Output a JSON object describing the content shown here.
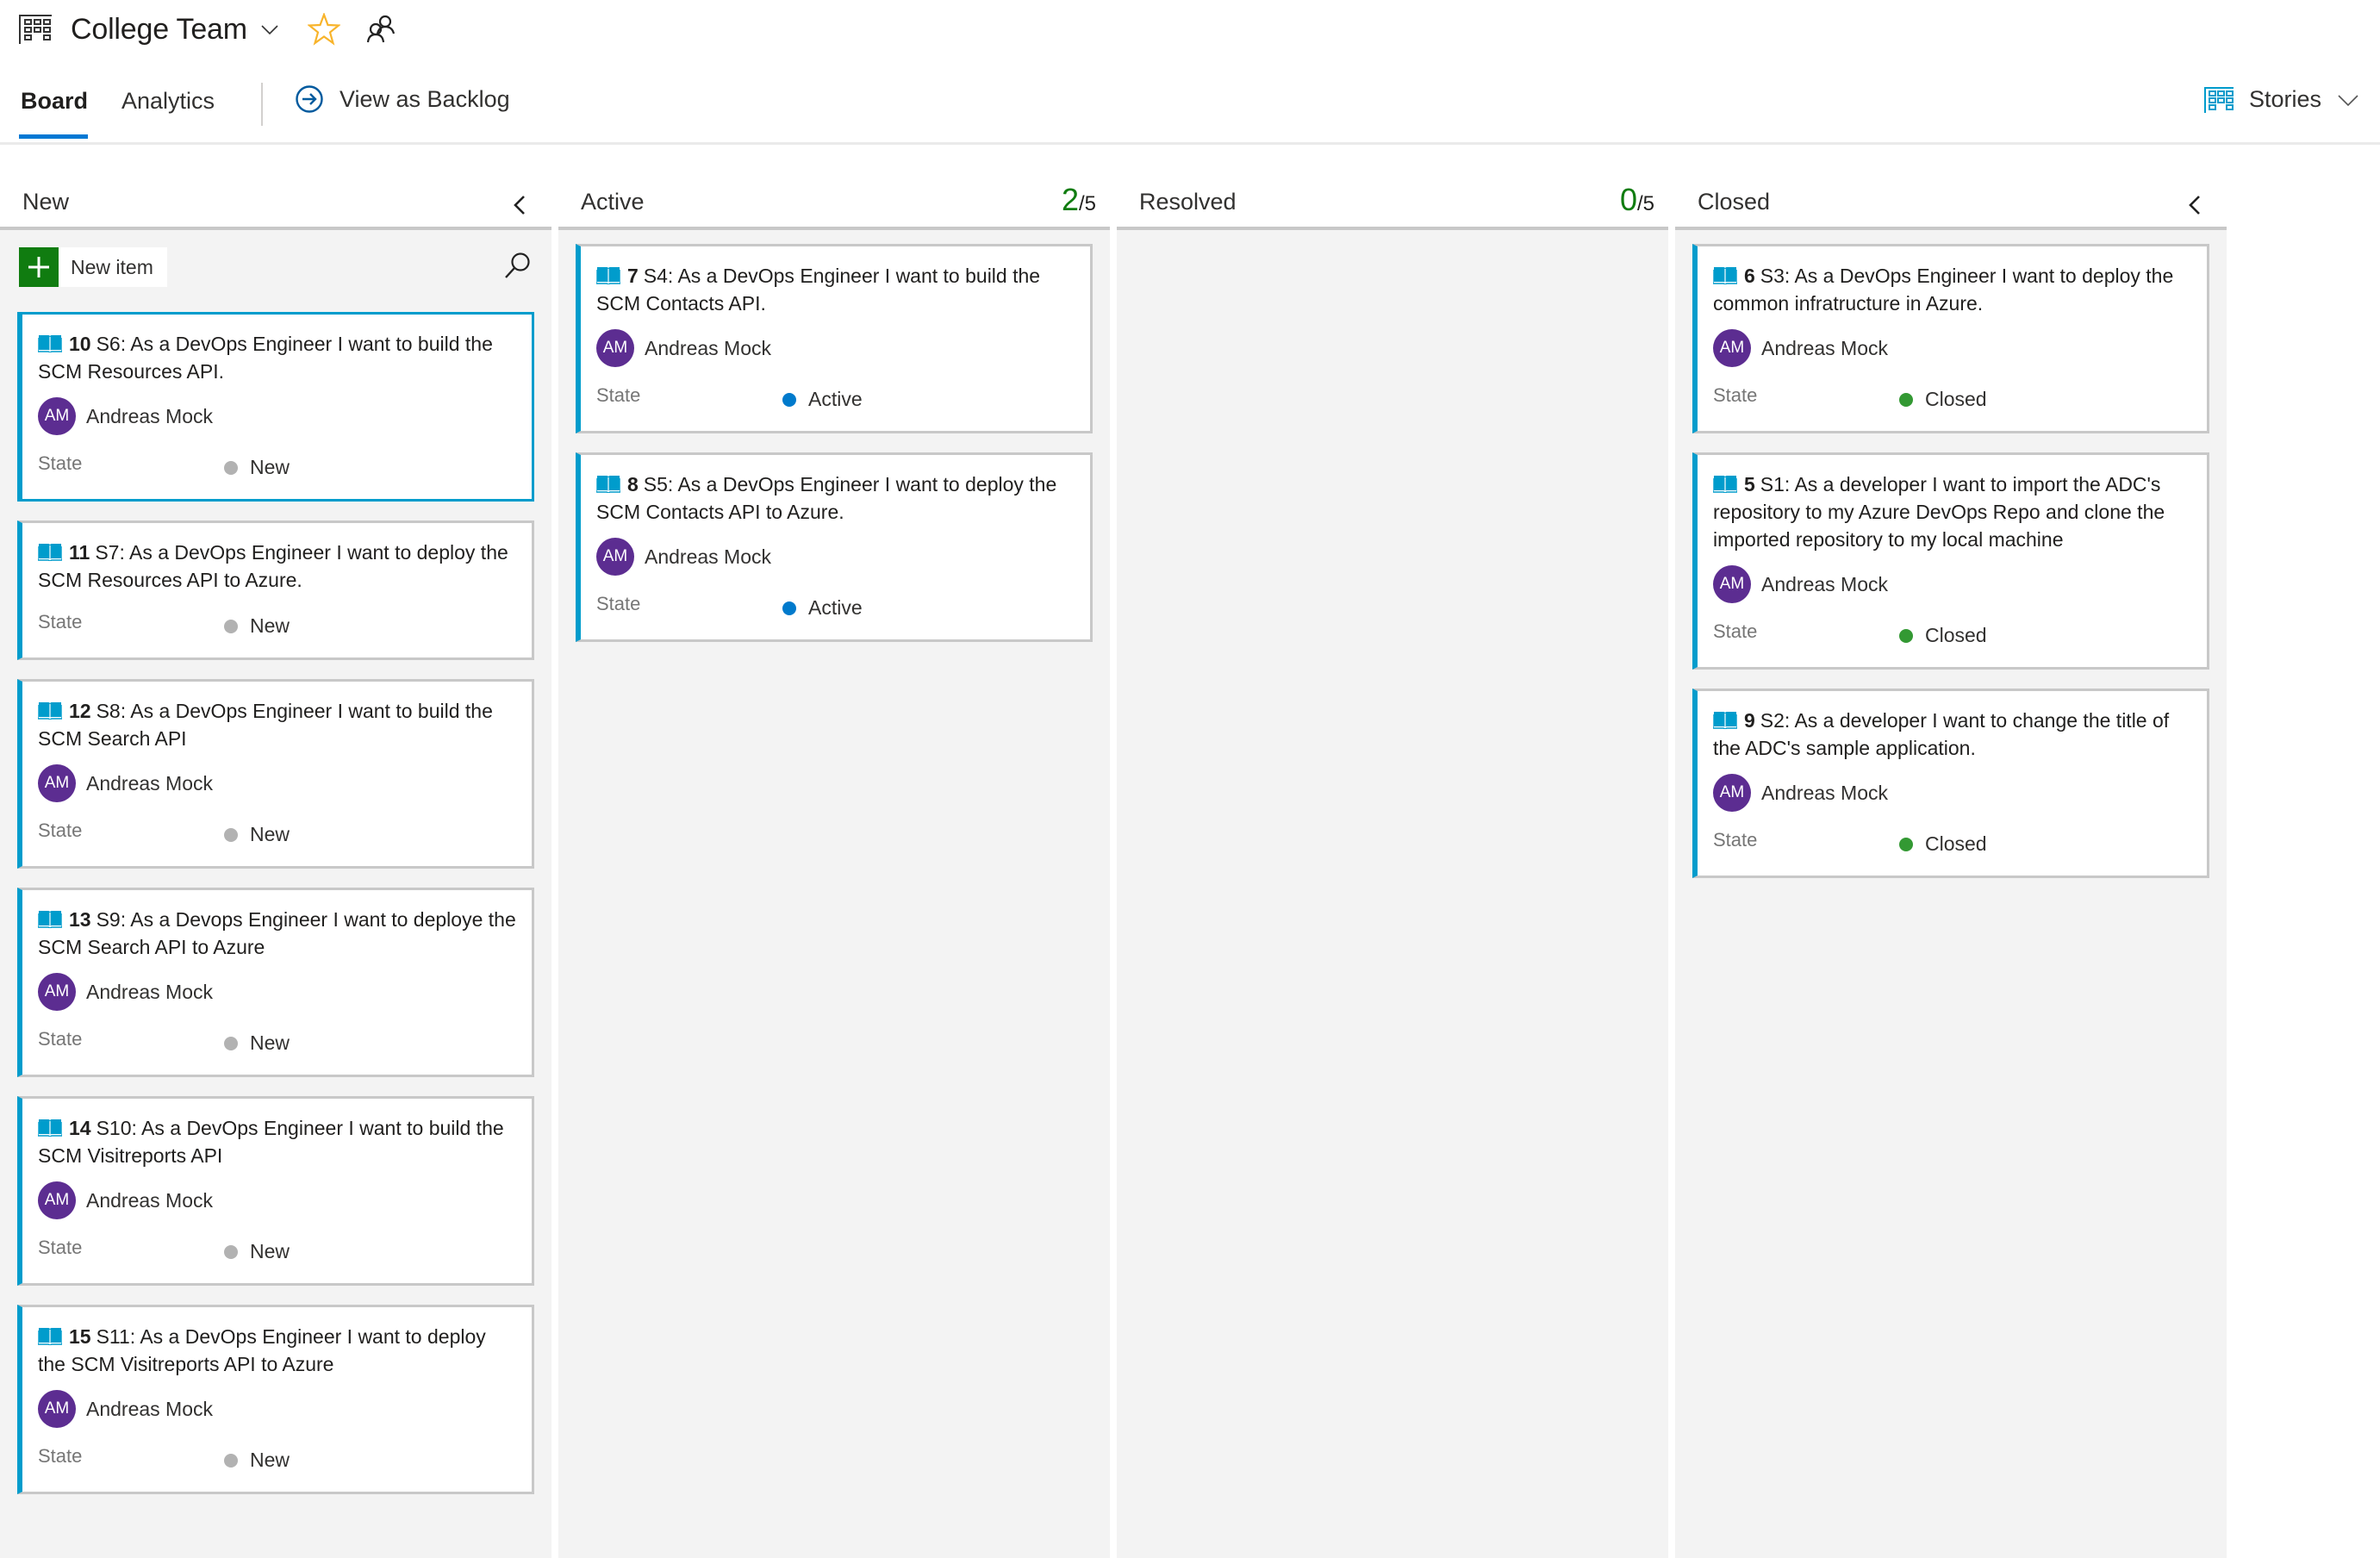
{
  "header": {
    "team_name": "College Team",
    "icons": {
      "board": "board-grid-icon",
      "chevron": "chevron-down-icon",
      "favorite": "star-icon",
      "team": "team-members-icon"
    },
    "favorite_color": "#f8b42b"
  },
  "tabs": {
    "items": [
      {
        "label": "Board",
        "active": true
      },
      {
        "label": "Analytics",
        "active": false
      }
    ],
    "view_as_backlog": "View as Backlog",
    "backlog_level": "Stories",
    "accent": "#0078d4"
  },
  "columns": [
    {
      "name": "New",
      "collapsible": true,
      "new_item_label": "New item"
    },
    {
      "name": "Active",
      "wip_current": "2",
      "wip_limit": "/5"
    },
    {
      "name": "Resolved",
      "wip_current": "0",
      "wip_limit": "/5"
    },
    {
      "name": "Closed",
      "collapsible": true
    }
  ],
  "state_label": "State",
  "state_colors": {
    "New": "#b2b2b2",
    "Active": "#007acc",
    "Closed": "#339933"
  },
  "cards": {
    "new": [
      {
        "id": "10",
        "title": "S6: As a DevOps Engineer I want to build the SCM Resources API.",
        "assignee": "Andreas Mock",
        "initials": "AM",
        "state": "New",
        "selected": true
      },
      {
        "id": "11",
        "title": "S7: As a DevOps Engineer I want to deploy the SCM Resources API to Azure.",
        "assignee": null,
        "initials": null,
        "state": "New"
      },
      {
        "id": "12",
        "title": "S8: As a DevOps Engineer I want to build the SCM Search API",
        "assignee": "Andreas Mock",
        "initials": "AM",
        "state": "New"
      },
      {
        "id": "13",
        "title": "S9: As a Devops Engineer I want to deploye the SCM Search API to Azure",
        "assignee": "Andreas Mock",
        "initials": "AM",
        "state": "New"
      },
      {
        "id": "14",
        "title": "S10: As a DevOps Engineer I want to build the SCM Visitreports API",
        "assignee": "Andreas Mock",
        "initials": "AM",
        "state": "New"
      },
      {
        "id": "15",
        "title": "S11: As a DevOps Engineer I want to deploy the SCM Visitreports API to Azure",
        "assignee": "Andreas Mock",
        "initials": "AM",
        "state": "New"
      }
    ],
    "active": [
      {
        "id": "7",
        "title": "S4: As a DevOps Engineer I want to build the SCM Contacts API.",
        "assignee": "Andreas Mock",
        "initials": "AM",
        "state": "Active"
      },
      {
        "id": "8",
        "title": "S5: As a DevOps Engineer I want to deploy the SCM Contacts API to Azure.",
        "assignee": "Andreas Mock",
        "initials": "AM",
        "state": "Active"
      }
    ],
    "resolved": [],
    "closed": [
      {
        "id": "6",
        "title": "S3: As a DevOps Engineer I want to deploy the common infratructure in Azure.",
        "assignee": "Andreas Mock",
        "initials": "AM",
        "state": "Closed"
      },
      {
        "id": "5",
        "title": "S1: As a developer I want to import the ADC's repository to my Azure DevOps Repo and clone the imported repository to my local machine",
        "assignee": "Andreas Mock",
        "initials": "AM",
        "state": "Closed"
      },
      {
        "id": "9",
        "title": "S2: As a developer I want to change the title of the ADC's sample application.",
        "assignee": "Andreas Mock",
        "initials": "AM",
        "state": "Closed"
      }
    ]
  }
}
